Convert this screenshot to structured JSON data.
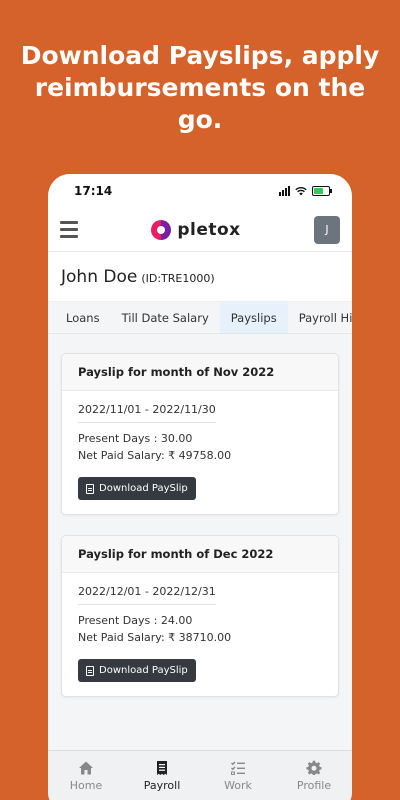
{
  "headline": "Download Payslips, apply reimbursements on the go.",
  "status": {
    "time": "17:14"
  },
  "app": {
    "logo_text": "pletox",
    "avatar_letter": "J"
  },
  "user": {
    "name": "John Doe",
    "id": "(ID:TRE1000)"
  },
  "tabs": [
    {
      "label": "Loans",
      "active": false
    },
    {
      "label": "Till Date Salary",
      "active": false
    },
    {
      "label": "Payslips",
      "active": true
    },
    {
      "label": "Payroll His",
      "active": false
    }
  ],
  "payslips": [
    {
      "title": "Payslip for month of Nov 2022",
      "period": "2022/11/01 - 2022/11/30",
      "present_days": "Present Days : 30.00",
      "net_salary": "Net Paid Salary: ₹ 49758.00",
      "button": "Download PaySlip"
    },
    {
      "title": "Payslip for month of Dec 2022",
      "period": "2022/12/01 - 2022/12/31",
      "present_days": "Present Days : 24.00",
      "net_salary": "Net Paid Salary: ₹ 38710.00",
      "button": "Download PaySlip"
    }
  ],
  "bottom_nav": [
    {
      "label": "Home",
      "icon": "home-icon",
      "active": false
    },
    {
      "label": "Payroll",
      "icon": "receipt-icon",
      "active": true
    },
    {
      "label": "Work",
      "icon": "checklist-icon",
      "active": false
    },
    {
      "label": "Profile",
      "icon": "gear-icon",
      "active": false
    }
  ],
  "colors": {
    "background": "#d5622a",
    "button": "#343a40",
    "active_tab": "#e7f1fb"
  }
}
